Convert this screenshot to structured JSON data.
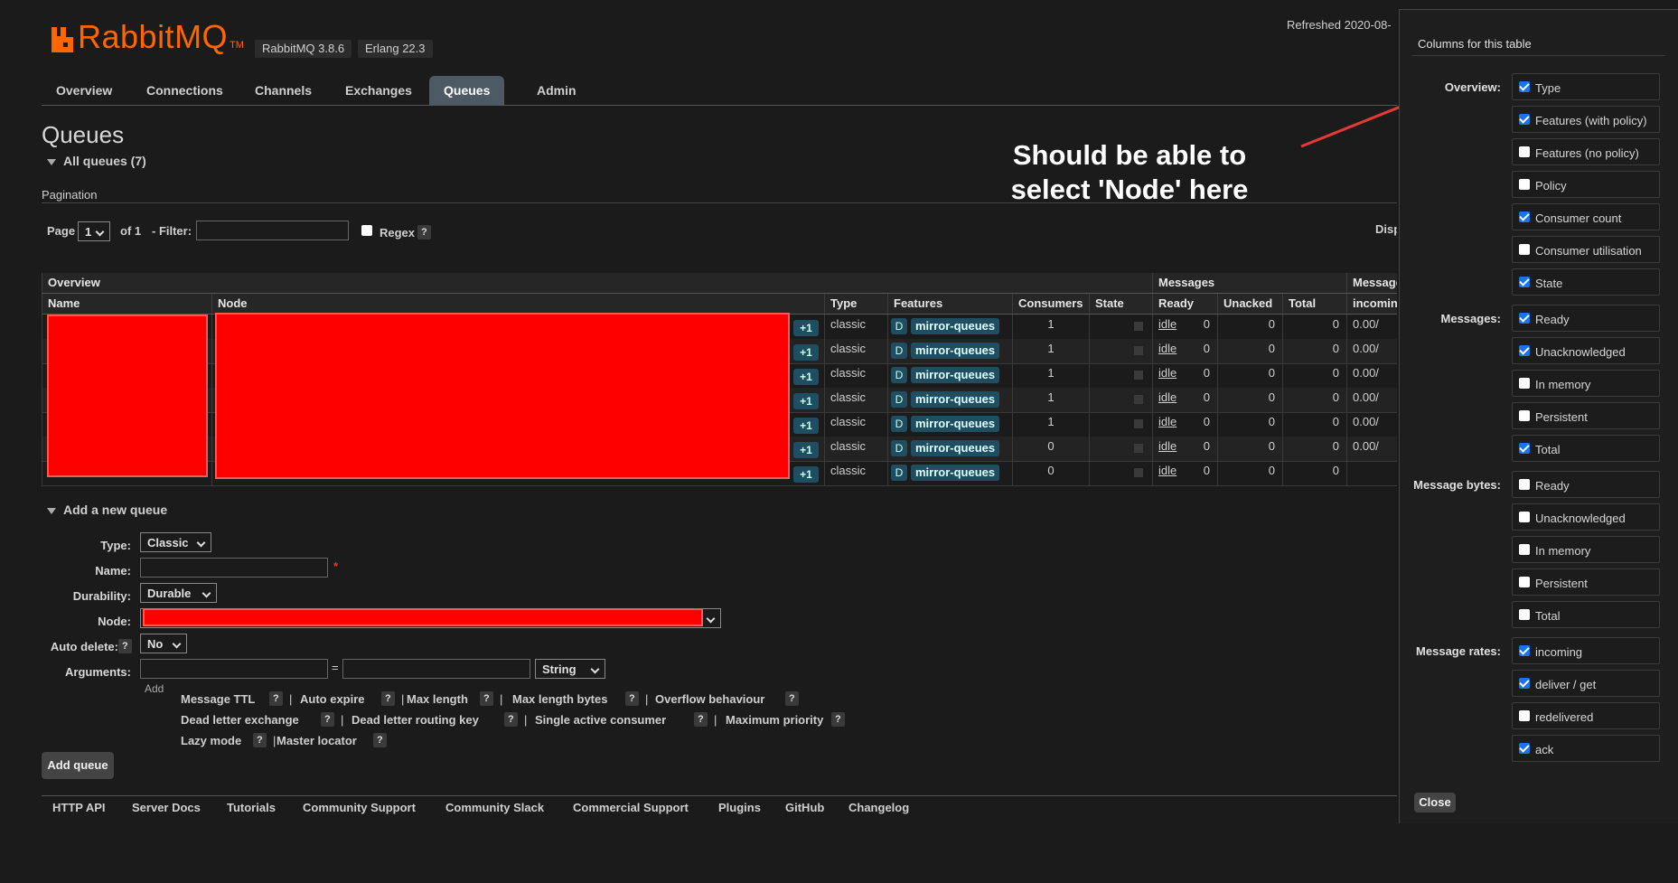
{
  "header": {
    "brand": "RabbitMQ",
    "tm": "TM",
    "version": "RabbitMQ 3.8.6",
    "erlang": "Erlang 22.3",
    "refreshed": "Refreshed 2020-08-"
  },
  "nav": {
    "tabs": [
      "Overview",
      "Connections",
      "Channels",
      "Exchanges",
      "Queues",
      "Admin"
    ],
    "active": "Queues"
  },
  "page": {
    "title": "Queues",
    "all_queues": "All queues (7)",
    "pagination_label": "Pagination"
  },
  "pagination": {
    "page_label": "Page",
    "page_value": "1",
    "of_label": "of 1",
    "filter_label": "- Filter:",
    "regex_label": "Regex",
    "help": "?",
    "disp_text": "Disp"
  },
  "table": {
    "group_headers": {
      "overview": "Overview",
      "messages": "Messages",
      "message_rates": "Message"
    },
    "columns": [
      "Name",
      "Node",
      "Type",
      "Features",
      "Consumers",
      "State",
      "Ready",
      "Unacked",
      "Total",
      "incomin"
    ],
    "rows": [
      {
        "plus": "+1",
        "type": "classic",
        "d": "D",
        "feature": "mirror-queues",
        "consumers": "1",
        "state": "idle",
        "ready": "0",
        "unacked": "0",
        "total": "0",
        "rate": "0.00/"
      },
      {
        "plus": "+1",
        "type": "classic",
        "d": "D",
        "feature": "mirror-queues",
        "consumers": "1",
        "state": "idle",
        "ready": "0",
        "unacked": "0",
        "total": "0",
        "rate": "0.00/"
      },
      {
        "plus": "+1",
        "type": "classic",
        "d": "D",
        "feature": "mirror-queues",
        "consumers": "1",
        "state": "idle",
        "ready": "0",
        "unacked": "0",
        "total": "0",
        "rate": "0.00/"
      },
      {
        "plus": "+1",
        "type": "classic",
        "d": "D",
        "feature": "mirror-queues",
        "consumers": "1",
        "state": "idle",
        "ready": "0",
        "unacked": "0",
        "total": "0",
        "rate": "0.00/"
      },
      {
        "plus": "+1",
        "type": "classic",
        "d": "D",
        "feature": "mirror-queues",
        "consumers": "1",
        "state": "idle",
        "ready": "0",
        "unacked": "0",
        "total": "0",
        "rate": "0.00/"
      },
      {
        "plus": "+1",
        "type": "classic",
        "d": "D",
        "feature": "mirror-queues",
        "consumers": "0",
        "state": "idle",
        "ready": "0",
        "unacked": "0",
        "total": "0",
        "rate": "0.00/"
      },
      {
        "plus": "+1",
        "type": "classic",
        "d": "D",
        "feature": "mirror-queues",
        "consumers": "0",
        "state": "idle",
        "ready": "0",
        "unacked": "0",
        "total": "0",
        "rate": ""
      }
    ]
  },
  "add_queue": {
    "section": "Add a new queue",
    "type_label": "Type:",
    "type_value": "Classic",
    "name_label": "Name:",
    "required": "*",
    "durability_label": "Durability:",
    "durability_value": "Durable",
    "node_label": "Node:",
    "auto_delete_label": "Auto delete:",
    "auto_delete_value": "No",
    "arguments_label": "Arguments:",
    "equals": "=",
    "arg_type": "String",
    "add_label": "Add",
    "hints_row1": [
      "Message TTL",
      "Auto expire",
      "Max length",
      "Max length bytes",
      "Overflow behaviour"
    ],
    "hints_row2": [
      "Dead letter exchange",
      "Dead letter routing key",
      "Single active consumer",
      "Maximum priority"
    ],
    "hints_row3": [
      "Lazy mode",
      "Master locator"
    ],
    "separator": "|",
    "button": "Add queue"
  },
  "annotation": {
    "line1": "Should be able to",
    "line2": "select 'Node' here",
    "color": "#e53935"
  },
  "footer": [
    "HTTP API",
    "Server Docs",
    "Tutorials",
    "Community Support",
    "Community Slack",
    "Commercial Support",
    "Plugins",
    "GitHub",
    "Changelog"
  ],
  "panel": {
    "title": "Columns for this table",
    "groups": [
      {
        "label": "Overview:",
        "options": [
          {
            "label": "Type",
            "checked": true
          },
          {
            "label": "Features (with policy)",
            "checked": true
          },
          {
            "label": "Features (no policy)",
            "checked": false
          },
          {
            "label": "Policy",
            "checked": false
          },
          {
            "label": "Consumer count",
            "checked": true
          },
          {
            "label": "Consumer utilisation",
            "checked": false
          },
          {
            "label": "State",
            "checked": true
          }
        ]
      },
      {
        "label": "Messages:",
        "options": [
          {
            "label": "Ready",
            "checked": true
          },
          {
            "label": "Unacknowledged",
            "checked": true
          },
          {
            "label": "In memory",
            "checked": false
          },
          {
            "label": "Persistent",
            "checked": false
          },
          {
            "label": "Total",
            "checked": true
          }
        ]
      },
      {
        "label": "Message bytes:",
        "options": [
          {
            "label": "Ready",
            "checked": false
          },
          {
            "label": "Unacknowledged",
            "checked": false
          },
          {
            "label": "In memory",
            "checked": false
          },
          {
            "label": "Persistent",
            "checked": false
          },
          {
            "label": "Total",
            "checked": false
          }
        ]
      },
      {
        "label": "Message rates:",
        "options": [
          {
            "label": "incoming",
            "checked": true
          },
          {
            "label": "deliver / get",
            "checked": true
          },
          {
            "label": "redelivered",
            "checked": false
          },
          {
            "label": "ack",
            "checked": true
          }
        ]
      }
    ],
    "close": "Close"
  }
}
